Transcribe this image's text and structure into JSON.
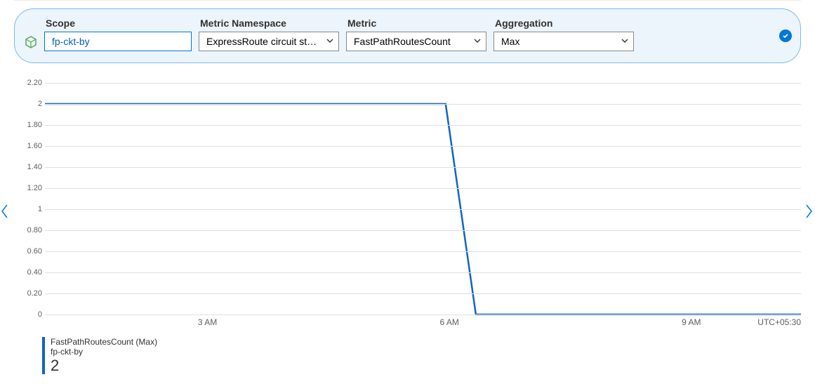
{
  "filters": {
    "scope_label": "Scope",
    "scope_value": "fp-ckt-by",
    "namespace_label": "Metric Namespace",
    "namespace_value": "ExpressRoute circuit sta...",
    "metric_label": "Metric",
    "metric_value": "FastPathRoutesCount",
    "aggregation_label": "Aggregation",
    "aggregation_value": "Max"
  },
  "legend": {
    "title": "FastPathRoutesCount (Max)",
    "subtitle": "fp-ckt-by",
    "value": "2"
  },
  "timezone": "UTC+05:30",
  "chart_data": {
    "type": "line",
    "title": "",
    "xlabel": "",
    "ylabel": "",
    "ylim": [
      0,
      2.2
    ],
    "y_ticks": [
      2.2,
      2,
      1.8,
      1.6,
      1.4,
      1.2,
      1,
      0.8,
      0.6,
      0.4,
      0.2,
      0
    ],
    "y_tick_labels": [
      "2.20",
      "2",
      "1.80",
      "1.60",
      "1.40",
      "1.20",
      "1",
      "0.80",
      "0.60",
      "0.40",
      "0.20",
      "0"
    ],
    "x_tick_positions_pct": [
      21.5,
      53.5,
      85.5
    ],
    "x_tick_labels": [
      "3 AM",
      "6 AM",
      "9 AM"
    ],
    "series": [
      {
        "name": "FastPathRoutesCount (Max)",
        "color": "#1164c5",
        "points_pct": [
          {
            "x": 0,
            "y": 2
          },
          {
            "x": 53,
            "y": 2
          },
          {
            "x": 57,
            "y": 0
          },
          {
            "x": 100,
            "y": 0
          }
        ]
      }
    ]
  }
}
